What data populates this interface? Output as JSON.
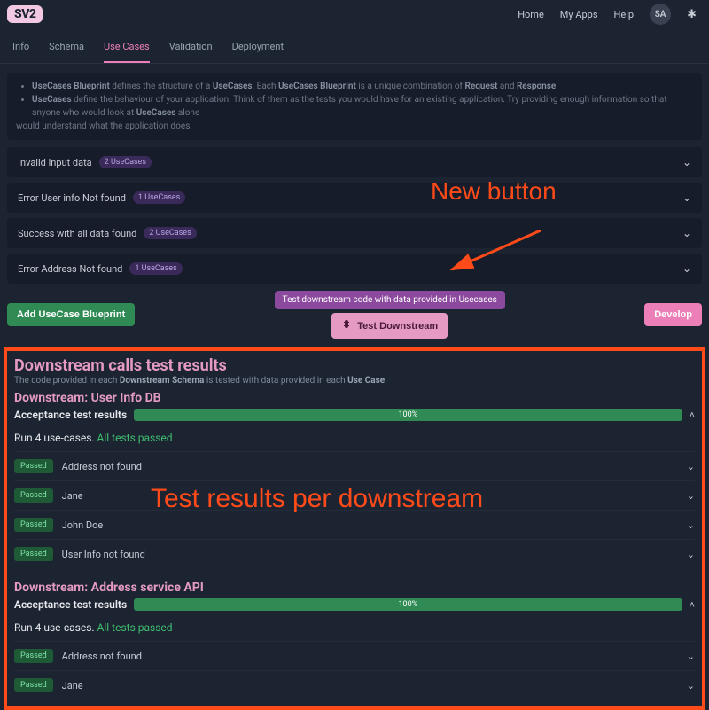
{
  "header": {
    "logo": "SV2",
    "nav": {
      "home": "Home",
      "myapps": "My Apps",
      "help": "Help"
    },
    "avatar_initials": "SA"
  },
  "tabs": {
    "info": "Info",
    "schema": "Schema",
    "usecases": "Use Cases",
    "validation": "Validation",
    "deployment": "Deployment"
  },
  "intro": {
    "b1_a": "UseCases Blueprint",
    "b1_b": " defines the structure of a ",
    "b1_c": "UseCases",
    "b1_d": ". Each ",
    "b1_e": "UseCases Blueprint",
    "b1_f": " is a unique combination of ",
    "b1_g": "Request",
    "b1_h": " and ",
    "b1_i": "Response",
    "b1_j": ".",
    "b2_a": "UseCases",
    "b2_b": " define the behaviour of your application. Think of them as the tests you would have for an existing application. Try providing enough information so that anyone who would look at ",
    "b2_c": "UseCases",
    "b2_d": " alone",
    "trailing": "would understand what the application does."
  },
  "usecases": [
    {
      "label": "Invalid input data",
      "count": "2 UseCases"
    },
    {
      "label": "Error User info Not found",
      "count": "1 UseCases"
    },
    {
      "label": "Success with all data found",
      "count": "2 UseCases"
    },
    {
      "label": "Error Address Not found",
      "count": "1 UseCases"
    }
  ],
  "buttons": {
    "add_blueprint": "Add UseCase Blueprint",
    "test_downstream": "Test Downstream",
    "develop": "Develop"
  },
  "tooltip": "Test downstream code with data provided in Usecases",
  "annotations": {
    "new_button": "New button",
    "results": "Test results per downstream"
  },
  "results": {
    "title": "Downstream calls test results",
    "subtitle_a": "The code provided in each ",
    "subtitle_b": "Downstream Schema",
    "subtitle_c": " is tested with data provided in each ",
    "subtitle_d": "Use Case",
    "acc_label": "Acceptance test results",
    "progress_pct": "100%",
    "run_a": "Run 4 use-cases. ",
    "run_b": "All tests passed",
    "passed": "Passed",
    "downstreams": [
      {
        "name": "Downstream: User Info DB",
        "tests": [
          "Address not found",
          "Jane",
          "John Doe",
          "User Info not found"
        ]
      },
      {
        "name": "Downstream: Address service API",
        "tests": [
          "Address not found",
          "Jane"
        ]
      }
    ]
  }
}
